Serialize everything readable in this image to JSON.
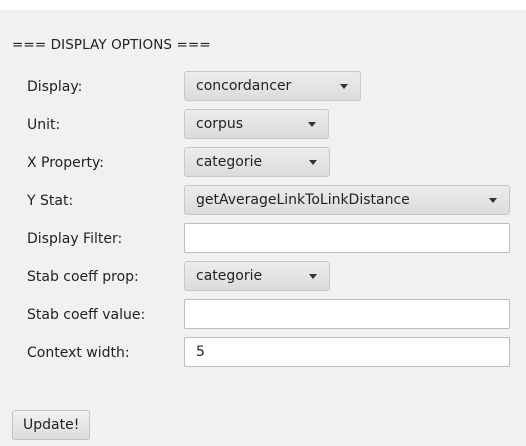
{
  "header": "=== DISPLAY OPTIONS ===",
  "fields": {
    "display": {
      "label": "Display:",
      "value": "concordancer"
    },
    "unit": {
      "label": "Unit:",
      "value": "corpus"
    },
    "x_property": {
      "label": "X Property:",
      "value": "categorie"
    },
    "y_stat": {
      "label": "Y Stat:",
      "value": "getAverageLinkToLinkDistance"
    },
    "display_filter": {
      "label": "Display Filter:",
      "value": ""
    },
    "stab_coeff_prop": {
      "label": "Stab coeff prop:",
      "value": "categorie"
    },
    "stab_coeff_value": {
      "label": "Stab coeff value:",
      "value": ""
    },
    "context_width": {
      "label": "Context width:",
      "value": "5"
    }
  },
  "update_button": "Update!",
  "icons": {
    "dropdown": "chevron-down-icon"
  }
}
